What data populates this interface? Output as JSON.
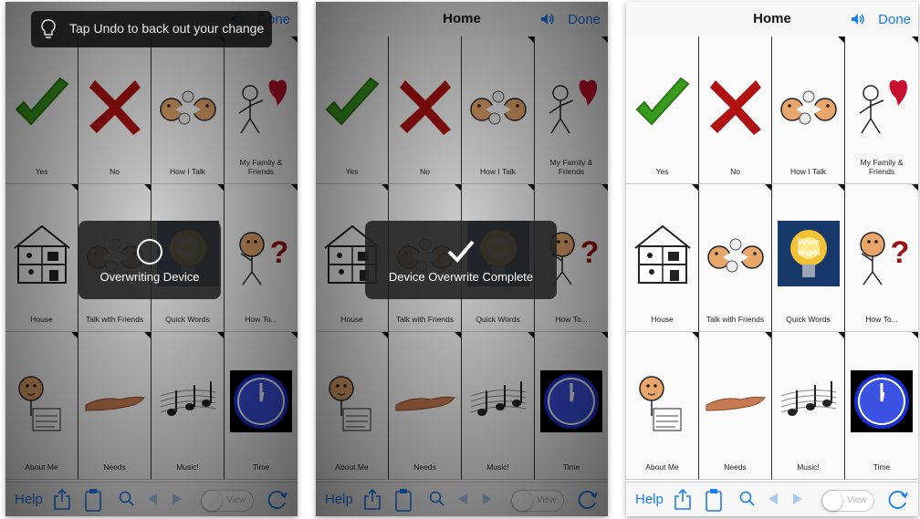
{
  "panels": [
    {
      "id": "p1",
      "title": "",
      "done_label": "Done",
      "tip": "Tap Undo to back out your change",
      "hud": "Overwriting Device",
      "hud_kind": "spinner",
      "dimmed": true
    },
    {
      "id": "p2",
      "title": "Home",
      "done_label": "Done",
      "tip": "",
      "hud": "Device Overwrite Complete",
      "hud_kind": "check",
      "dimmed": true
    },
    {
      "id": "p3",
      "title": "Home",
      "done_label": "Done",
      "tip": "",
      "hud": "",
      "hud_kind": "none",
      "dimmed": false
    }
  ],
  "cells": [
    {
      "label": "Yes",
      "icon": "check-mark-icon",
      "folder": false
    },
    {
      "label": "No",
      "icon": "red-x-icon",
      "folder": false
    },
    {
      "label": "How I Talk",
      "icon": "talking-faces-icon",
      "folder": true
    },
    {
      "label": "My Family & Friends",
      "icon": "stick-figure-heart-icon",
      "folder": true
    },
    {
      "label": "House",
      "icon": "house-icon",
      "folder": true
    },
    {
      "label": "Talk with Friends",
      "icon": "talking-faces-icon",
      "folder": true
    },
    {
      "label": "Quick Words",
      "icon": "power-words-bulb-icon",
      "folder": true
    },
    {
      "label": "How To...",
      "icon": "thinking-question-icon",
      "folder": true
    },
    {
      "label": "About Me",
      "icon": "person-name-card-icon",
      "folder": true
    },
    {
      "label": "Needs",
      "icon": "open-hand-icon",
      "folder": true
    },
    {
      "label": "Music!",
      "icon": "music-notes-icon",
      "folder": true
    },
    {
      "label": "Time",
      "icon": "clock-icon",
      "folder": true
    }
  ],
  "quick_words_image_text": "Power Words",
  "about_me_card_text": "NAME ADDRESS PHONE #",
  "toolbar": {
    "help_label": "Help",
    "view_label": "View"
  },
  "colors": {
    "accent": "#1a7cf7",
    "yes_green": "#3a9a1e",
    "no_red": "#b01212",
    "heart_red": "#c8102e",
    "clock_blue": "#1a2fd0"
  }
}
